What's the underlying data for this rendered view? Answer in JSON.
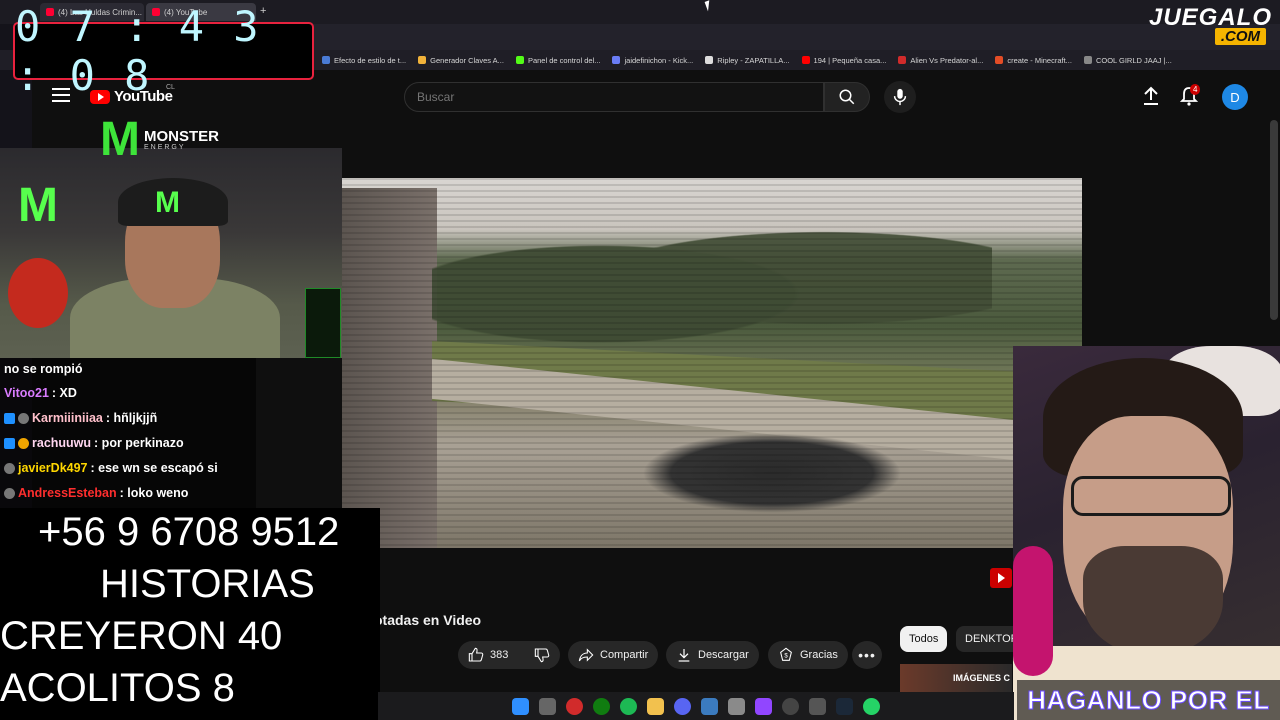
{
  "browser": {
    "tabs": [
      {
        "title": "(4) Las Huldas Crimin..."
      },
      {
        "title": "(4) YouTube"
      }
    ],
    "bookmarks": [
      {
        "label": "Efecto de estilo de t...",
        "color": "#4a7bd5"
      },
      {
        "label": "Generador Claves A...",
        "color": "#f0b23a"
      },
      {
        "label": "Panel de control del...",
        "color": "#53fc18"
      },
      {
        "label": "jaidefinichon - Kick...",
        "color": "#6a7df5"
      },
      {
        "label": "Ripley - ZAPATILLA...",
        "color": "#dddddd"
      },
      {
        "label": "194 | Pequeña casa...",
        "color": "#ff0000"
      },
      {
        "label": "Alien Vs Predator-al...",
        "color": "#d12b2b"
      },
      {
        "label": "create - Minecraft...",
        "color": "#e44d26"
      },
      {
        "label": "COOL GIRLD JAAJ |...",
        "color": "#888888"
      }
    ]
  },
  "youtube": {
    "logo_text": "YouTube",
    "country": "CL",
    "search_placeholder": "Buscar",
    "notification_count": "4",
    "avatar_letter": "D",
    "video_title_partial": "otadas en Video",
    "actions": {
      "likes": "383",
      "share": "Compartir",
      "download": "Descargar",
      "thanks": "Gracias",
      "more": "•••"
    },
    "chips": [
      "Todos",
      "DENKTOR"
    ],
    "related_thumb_text": "IMÁGENES C"
  },
  "stream_overlay": {
    "clock": "07:43:08",
    "brand_logo": {
      "line1": "JUEGALO",
      "line2": ".COM"
    },
    "sponsor": {
      "name": "MONSTER",
      "tagline": "ENERGY"
    },
    "chat": [
      {
        "user": "",
        "message": "no se rompió",
        "color": "#ffffff"
      },
      {
        "user": "Vitoo21",
        "message": ": XD",
        "color": "#d97cff"
      },
      {
        "user": "Karmiiiniiaa",
        "message": ": hñljkjjñ",
        "color": "#ffc0cb"
      },
      {
        "user": "rachuuwu",
        "message": ": por perkinazo",
        "color": "#ffd6f0"
      },
      {
        "user": "javierDk497",
        "message": ": ese wn se escapó si",
        "color": "#ffd700"
      },
      {
        "user": "AndressEsteban",
        "message": ": loko weno",
        "color": "#ff2e2e"
      }
    ],
    "phone": "+56 9 6708 9512",
    "lines": [
      "HISTORIAS",
      "CREYERON 40",
      "ACOLITOS 8"
    ],
    "banner": "HAGANLO POR EL"
  },
  "colors": {
    "youtube_red": "#ff0000",
    "clock_border": "#e8223e",
    "clock_digits": "#bff6ff",
    "monster_green": "#3ee43a",
    "juegalo_yellow": "#f5b400"
  }
}
